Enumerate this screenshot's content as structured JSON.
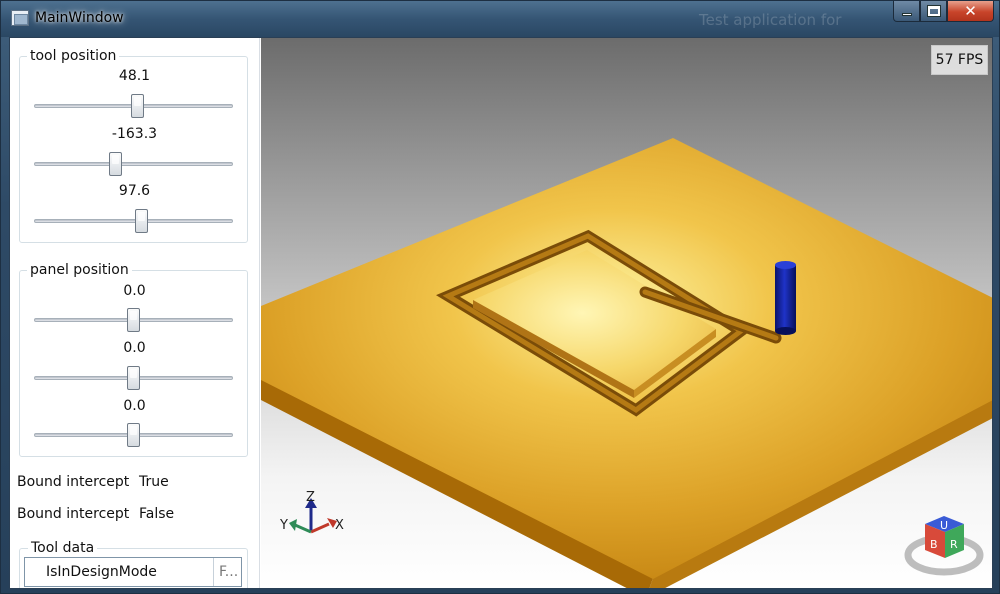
{
  "window": {
    "title": "MainWindow",
    "background_text": "Test application for"
  },
  "tool_position": {
    "legend": "tool position",
    "sliders": [
      {
        "value_label": "48.1",
        "fraction": 0.52
      },
      {
        "value_label": "-163.3",
        "fraction": 0.41
      },
      {
        "value_label": "97.6",
        "fraction": 0.54
      }
    ]
  },
  "panel_position": {
    "legend": "panel position",
    "sliders": [
      {
        "value_label": "0.0",
        "fraction": 0.5
      },
      {
        "value_label": "0.0",
        "fraction": 0.5
      },
      {
        "value_label": "0.0",
        "fraction": 0.5
      }
    ]
  },
  "bound": [
    {
      "label": "Bound intercept",
      "value": "True"
    },
    {
      "label": "Bound intercept",
      "value": "False"
    }
  ],
  "tool_data": {
    "legend": "Tool data",
    "row_name": "IsInDesignMode",
    "row_value": "F..."
  },
  "viewport": {
    "fps": "57 FPS",
    "axes": {
      "z": "Z",
      "y": "Y",
      "x": "X"
    },
    "view_cube": {
      "top": "U",
      "front": "B",
      "right": "R"
    },
    "colors": {
      "panel": "#d89a1c",
      "cylinder": "#0f1d8c"
    }
  }
}
